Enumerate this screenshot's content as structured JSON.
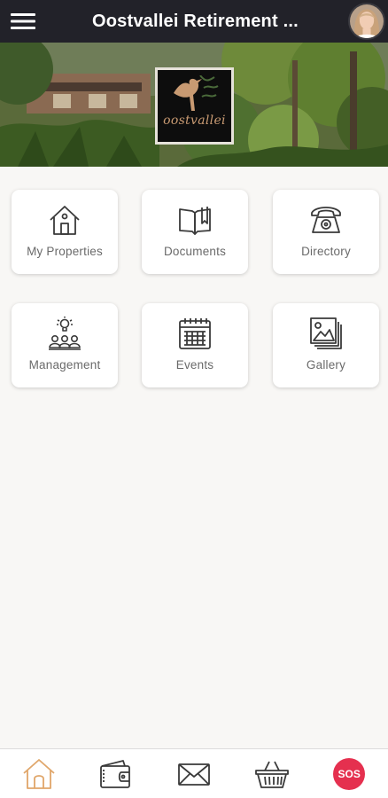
{
  "header": {
    "title": "Oostvallei Retirement ...",
    "menu_icon": "hamburger-menu-icon",
    "avatar": "user-avatar"
  },
  "hero": {
    "logo_text": "oostvallei",
    "logo_icon": "bird-logo-icon"
  },
  "tiles": [
    {
      "label": "My Properties",
      "icon": "house-icon"
    },
    {
      "label": "Documents",
      "icon": "open-book-icon"
    },
    {
      "label": "Directory",
      "icon": "telephone-icon"
    },
    {
      "label": "Management",
      "icon": "team-lightbulb-icon"
    },
    {
      "label": "Events",
      "icon": "calendar-icon"
    },
    {
      "label": "Gallery",
      "icon": "photo-gallery-icon"
    }
  ],
  "bottom_nav": {
    "items": [
      {
        "icon": "home-icon",
        "active": true
      },
      {
        "icon": "wallet-icon",
        "active": false
      },
      {
        "icon": "mail-icon",
        "active": false
      },
      {
        "icon": "basket-icon",
        "active": false
      },
      {
        "icon": "sos-icon",
        "active": false,
        "label": "SOS"
      }
    ]
  },
  "colors": {
    "header_bg": "#222229",
    "page_bg": "#f8f7f5",
    "icon_stroke": "#3a3a3a",
    "active_nav": "#e0a66a",
    "sos_red": "#e5304f"
  }
}
